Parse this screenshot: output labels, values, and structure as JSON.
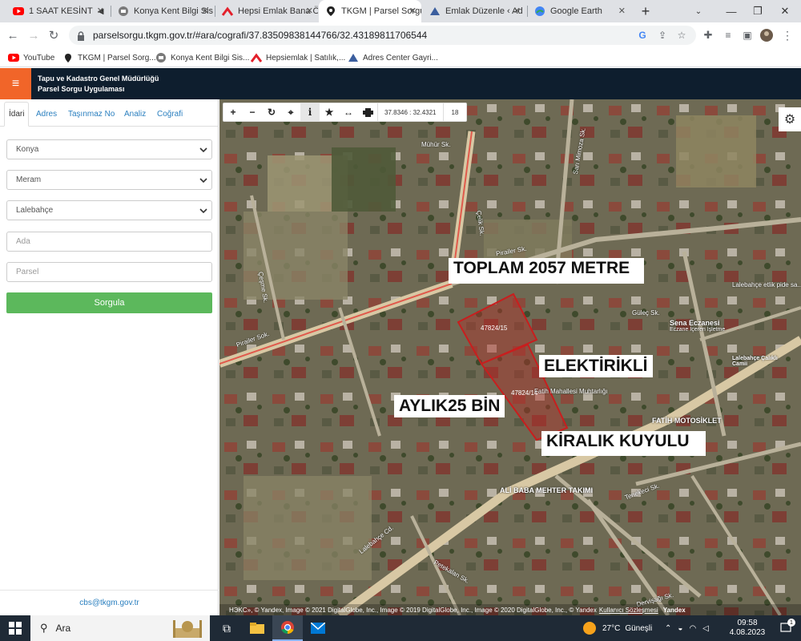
{
  "browser": {
    "tabs": [
      {
        "title": "1 SAAT KESİNT",
        "icon": "youtube-icon",
        "active": false
      },
      {
        "title": "Konya Kent Bilgi Sis",
        "icon": "city-icon",
        "active": false
      },
      {
        "title": "Hepsi Emlak Bana Ö",
        "icon": "hepsiemlak-icon",
        "active": false
      },
      {
        "title": "TKGM | Parsel Sorgu",
        "icon": "map-pin-icon",
        "active": true
      },
      {
        "title": "Emlak Düzenle ‹ Ad",
        "icon": "adres-icon",
        "active": false
      },
      {
        "title": "Google Earth",
        "icon": "earth-icon",
        "active": false
      }
    ],
    "url": "parselsorgu.tkgm.gov.tr/#ara/cografi/37.83509838144766/32.43189811706544",
    "bookmarks": [
      {
        "label": "YouTube",
        "icon": "youtube-icon"
      },
      {
        "label": "TKGM | Parsel Sorg...",
        "icon": "map-pin-icon"
      },
      {
        "label": "Konya Kent Bilgi Sis...",
        "icon": "city-icon"
      },
      {
        "label": "Hepsiemlak | Satılık,...",
        "icon": "hepsiemlak-icon"
      },
      {
        "label": "Adres Center Gayri...",
        "icon": "adres-icon"
      }
    ]
  },
  "app": {
    "title_line1": "Tapu ve Kadastro Genel Müdürlüğü",
    "title_line2": "Parsel Sorgu Uygulaması"
  },
  "panel": {
    "tabs": [
      "İdari",
      "Adres",
      "Taşınmaz No",
      "Analiz",
      "Coğrafi"
    ],
    "active_tab": "İdari",
    "province": "Konya",
    "district": "Meram",
    "neighborhood": "Lalebahçe",
    "ada_placeholder": "Ada",
    "parsel_placeholder": "Parsel",
    "submit_label": "Sorgula",
    "footer_email": "cbs@tkgm.gov.tr"
  },
  "map": {
    "coordinates": "37.8346 : 32.4321",
    "zoom_level": "18",
    "overlay_labels": {
      "total_area": "TOPLAM 2057 METRE",
      "electric": "ELEKTİRİKLİ",
      "rent": "AYLIK25 BİN",
      "rental": "KİRALIK KUYULU"
    },
    "parcels": [
      "47824/15",
      "47824/14"
    ],
    "streets": [
      "Mühür Sk.",
      "Çelik Sk.",
      "Pirailer Sk.",
      "Pirailer Sok.",
      "Güleç Sk.",
      "Lalebahçe Cd.",
      "Tenekeci Sk.",
      "Petekalan Sk.",
      "Dervişağı Sk.",
      "Çeşme Sk.",
      "Sarı Mimoza Sk."
    ],
    "pois": [
      "Sena Eczanesi",
      "Eczane İçeren İşletme",
      "FATİH MOTOSİKLET",
      "ALİ BABA MEHTER TAKIMI",
      "Lalebahçe Çalıklı Camii",
      "Fatih Mahallesi Muhtarlığı",
      "Lalebahçe etlik pide sa..."
    ],
    "attribution": "HЭKC», © Yandex, Image © 2021 DigitalGlobe, Inc., Image © 2019 DigitalGlobe, Inc., Image © 2020 DigitalGlobe, Inc., © Yandex",
    "attribution_link": "Kullanıcı Sözleşmesi",
    "attribution_tail": "Yandex"
  },
  "taskbar": {
    "search_label": "Ara",
    "temperature": "27°C",
    "weather": "Güneşli",
    "time": "09:58",
    "date": "4.08.2023",
    "notification_count": "1"
  }
}
